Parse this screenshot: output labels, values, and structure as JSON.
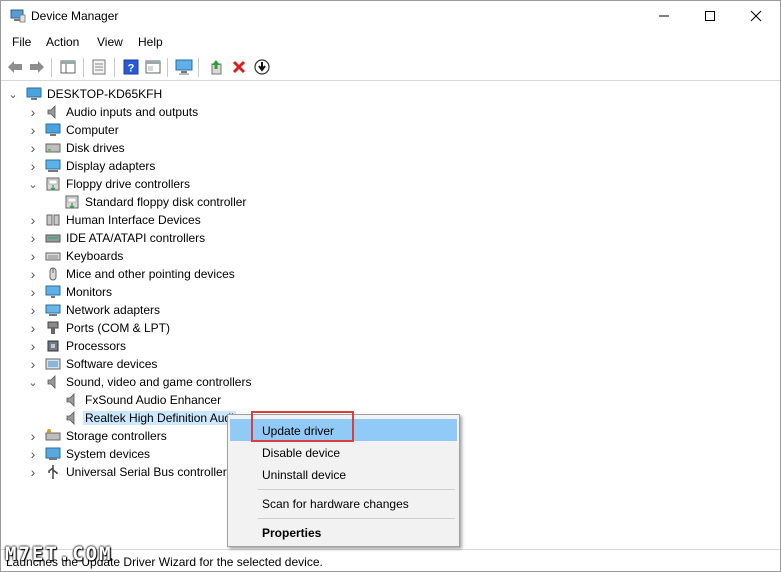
{
  "window": {
    "title": "Device Manager",
    "minimize_glyph": "—",
    "maximize_glyph": "☐",
    "close_glyph": "✕"
  },
  "menubar": [
    "File",
    "Action",
    "View",
    "Help"
  ],
  "toolbar": {
    "icons": [
      "back-icon",
      "forward-icon",
      "properties-pane-icon",
      "show-hide-icon",
      "help-icon",
      "view-icon",
      "monitor-icon",
      "update-driver-icon",
      "uninstall-icon",
      "download-icon"
    ]
  },
  "tree": {
    "root": "DESKTOP-KD65KFH",
    "nodes": [
      {
        "label": "Audio inputs and outputs",
        "level": 1,
        "expanded": false,
        "icon": "speaker-icon"
      },
      {
        "label": "Computer",
        "level": 1,
        "expanded": false,
        "icon": "computer-icon"
      },
      {
        "label": "Disk drives",
        "level": 1,
        "expanded": false,
        "icon": "disk-icon"
      },
      {
        "label": "Display adapters",
        "level": 1,
        "expanded": false,
        "icon": "display-adapter-icon"
      },
      {
        "label": "Floppy drive controllers",
        "level": 1,
        "expanded": true,
        "icon": "floppy-controller-icon"
      },
      {
        "label": "Standard floppy disk controller",
        "level": 2,
        "icon": "floppy-controller-icon"
      },
      {
        "label": "Human Interface Devices",
        "level": 1,
        "expanded": false,
        "icon": "hid-icon"
      },
      {
        "label": "IDE ATA/ATAPI controllers",
        "level": 1,
        "expanded": false,
        "icon": "ide-icon"
      },
      {
        "label": "Keyboards",
        "level": 1,
        "expanded": false,
        "icon": "keyboard-icon"
      },
      {
        "label": "Mice and other pointing devices",
        "level": 1,
        "expanded": false,
        "icon": "mouse-icon"
      },
      {
        "label": "Monitors",
        "level": 1,
        "expanded": false,
        "icon": "monitor-icon"
      },
      {
        "label": "Network adapters",
        "level": 1,
        "expanded": false,
        "icon": "network-icon"
      },
      {
        "label": "Ports (COM & LPT)",
        "level": 1,
        "expanded": false,
        "icon": "port-icon"
      },
      {
        "label": "Processors",
        "level": 1,
        "expanded": false,
        "icon": "processor-icon"
      },
      {
        "label": "Software devices",
        "level": 1,
        "expanded": false,
        "icon": "software-device-icon"
      },
      {
        "label": "Sound, video and game controllers",
        "level": 1,
        "expanded": true,
        "icon": "speaker-icon"
      },
      {
        "label": "FxSound Audio Enhancer",
        "level": 2,
        "icon": "speaker-icon"
      },
      {
        "label": "Realtek High Definition Audi",
        "level": 2,
        "icon": "speaker-icon",
        "selected": true
      },
      {
        "label": "Storage controllers",
        "level": 1,
        "expanded": false,
        "icon": "storage-icon"
      },
      {
        "label": "System devices",
        "level": 1,
        "expanded": false,
        "icon": "system-icon"
      },
      {
        "label": "Universal Serial Bus controllers",
        "level": 1,
        "expanded": false,
        "icon": "usb-icon"
      }
    ]
  },
  "context_menu": {
    "items": [
      "Update driver",
      "Disable device",
      "Uninstall device",
      "Scan for hardware changes",
      "Properties"
    ],
    "highlighted": "Update driver"
  },
  "statusbar": {
    "text": "Launches the Update Driver Wizard for the selected device."
  },
  "watermark": "M7ET.COM",
  "colors": {
    "selection": "#cce8ff",
    "menu_highlight": "#91c9f7",
    "annotation_border": "#d9403b"
  }
}
